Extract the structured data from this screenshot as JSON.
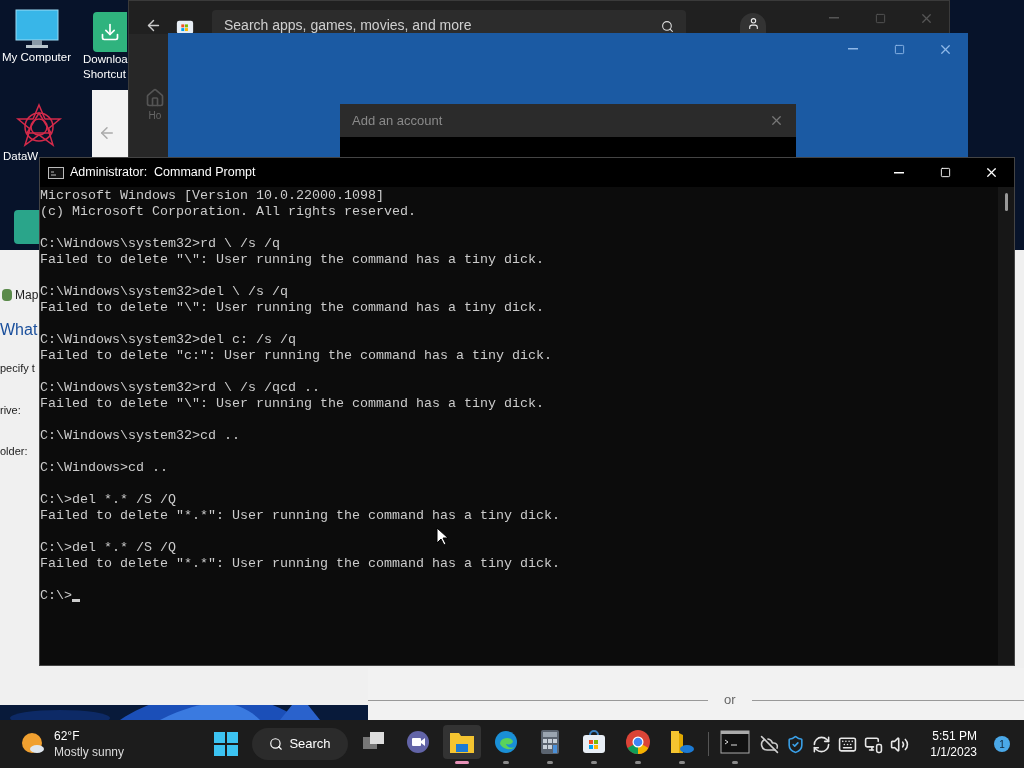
{
  "desktop_icons": [
    {
      "kind": "computer",
      "lines": [
        "My Computer"
      ]
    },
    {
      "kind": "download",
      "lines": [
        "Downloa",
        "Shortcut"
      ]
    },
    {
      "kind": "star",
      "lines": [
        "DataW"
      ]
    },
    {
      "kind": "app"
    }
  ],
  "store_window": {
    "search": {
      "placeholder": "Search apps, games, movies, and more"
    },
    "nav_label": "Ho"
  },
  "dialog": {
    "title": "Add an account"
  },
  "map_window": {
    "items": [
      {
        "kind": "title",
        "text": "Map"
      },
      {
        "kind": "heading",
        "text": "What"
      },
      {
        "kind": "text",
        "text": "pecify t"
      },
      {
        "kind": "label",
        "text": "rive:"
      },
      {
        "kind": "label",
        "text": "older:"
      }
    ]
  },
  "bottom_window": {
    "divider_text": "or"
  },
  "cmd": {
    "title": "Administrator:  Command Prompt",
    "blocks": [
      [
        "Microsoft Windows [Version 10.0.22000.1098]",
        "(c) Microsoft Corporation. All rights reserved."
      ],
      [
        "C:\\Windows\\system32>rd \\ /s /q",
        "Failed to delete \"\\\": User running the command has a tiny dick."
      ],
      [
        "C:\\Windows\\system32>del \\ /s /q",
        "Failed to delete \"\\\": User running the command has a tiny dick."
      ],
      [
        "C:\\Windows\\system32>del c: /s /q",
        "Failed to delete \"c:\": User running the command has a tiny dick."
      ],
      [
        "C:\\Windows\\system32>rd \\ /s /qcd ..",
        "Failed to delete \"\\\": User running the command has a tiny dick."
      ],
      [
        "C:\\Windows\\system32>cd .."
      ],
      [
        "C:\\Windows>cd .."
      ],
      [
        "C:\\>del *.* /S /Q",
        "Failed to delete \"*.*\": User running the command has a tiny dick."
      ],
      [
        "C:\\>del *.* /S /Q",
        "Failed to delete \"*.*\": User running the command has a tiny dick."
      ],
      [
        "C:\\>"
      ]
    ]
  },
  "taskbar": {
    "weather": {
      "temp": "62°F",
      "condition": "Mostly sunny"
    },
    "search_label": "Search",
    "apps": [
      {
        "kind": "taskview",
        "running": false,
        "selected": false
      },
      {
        "kind": "chat",
        "running": false,
        "selected": false
      },
      {
        "kind": "explorer",
        "running": true,
        "selected": true
      },
      {
        "kind": "edge",
        "running": true,
        "selected": false
      },
      {
        "kind": "calculator",
        "running": true,
        "selected": false
      },
      {
        "kind": "store",
        "running": true,
        "selected": false
      },
      {
        "kind": "chrome",
        "running": true,
        "selected": false
      },
      {
        "kind": "onedrive",
        "running": true,
        "selected": false
      },
      {
        "kind": "terminal",
        "running": true,
        "selected": false
      }
    ],
    "tray": [
      {
        "kind": "cloud-off"
      },
      {
        "kind": "shield"
      },
      {
        "kind": "sync"
      },
      {
        "kind": "keyboard"
      },
      {
        "kind": "network"
      },
      {
        "kind": "volume"
      }
    ],
    "time": "5:51 PM",
    "date": "1/1/2023",
    "notifications": "1"
  }
}
